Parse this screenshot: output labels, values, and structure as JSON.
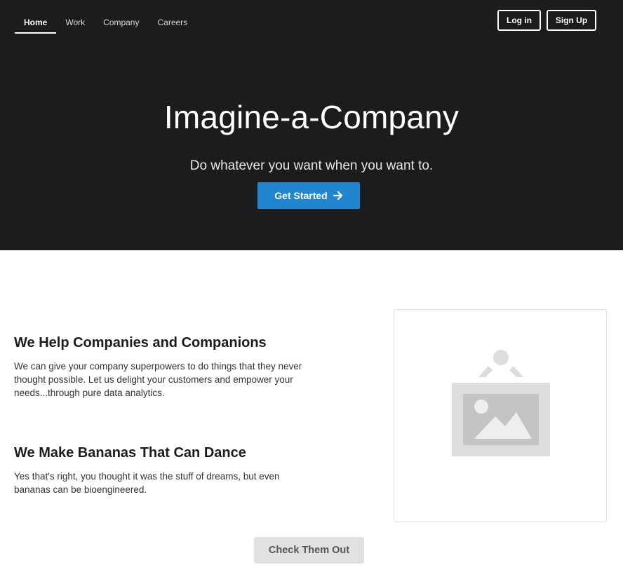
{
  "nav": {
    "items": [
      {
        "label": "Home",
        "active": true
      },
      {
        "label": "Work",
        "active": false
      },
      {
        "label": "Company",
        "active": false
      },
      {
        "label": "Careers",
        "active": false
      }
    ]
  },
  "auth": {
    "login_label": "Log in",
    "signup_label": "Sign Up"
  },
  "hero": {
    "title": "Imagine-a-Company",
    "subtitle": "Do whatever you want when you want to.",
    "cta_label": "Get Started",
    "cta_icon": "arrow-right-icon"
  },
  "sections": [
    {
      "title": "We Help Companies and Companions",
      "body": "We can give your company superpowers to do things that they never thought possible. Let us delight your customers and empower your needs...through pure data analytics."
    },
    {
      "title": "We Make Bananas That Can Dance",
      "body": "Yes that's right, you thought it was the stuff of dreams, but even bananas can be bioengineered."
    }
  ],
  "image_card": {
    "icon": "image-placeholder-icon"
  },
  "secondary_button": {
    "label": "Check Them Out"
  },
  "colors": {
    "hero_bg": "#1c1c1e",
    "primary": "#2185d0",
    "secondary_bg": "#e0e1e2"
  }
}
